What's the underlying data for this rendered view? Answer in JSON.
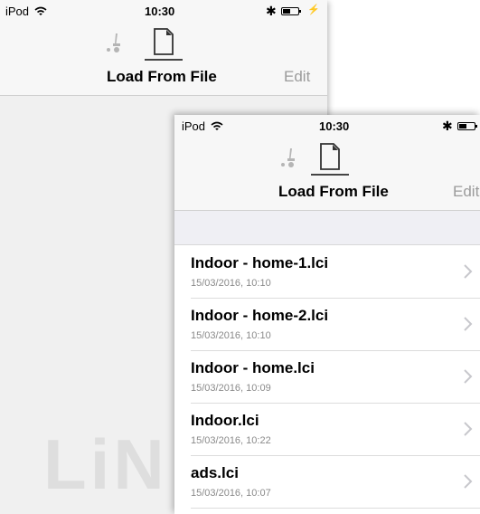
{
  "status_bar": {
    "carrier": "iPod",
    "time": "10:30",
    "bluetooth": "✱",
    "charging": "⚡"
  },
  "navbar": {
    "title": "Load From File",
    "edit_label": "Edit",
    "tabs": [
      {
        "icon": "wheelchair-icon",
        "selected": false
      },
      {
        "icon": "file-icon",
        "selected": true
      }
    ]
  },
  "watermark": {
    "text": "LiN"
  },
  "files": [
    {
      "name": "Indoor - home-1.lci",
      "date": "15/03/2016, 10:10"
    },
    {
      "name": "Indoor - home-2.lci",
      "date": "15/03/2016, 10:10"
    },
    {
      "name": "Indoor - home.lci",
      "date": "15/03/2016, 10:09"
    },
    {
      "name": "Indoor.lci",
      "date": "15/03/2016, 10:22"
    },
    {
      "name": "ads.lci",
      "date": "15/03/2016, 10:07"
    }
  ],
  "colors": {
    "navbar_bg": "#f7f7f7",
    "edit_text": "#9b9b9b",
    "subtitle_text": "#8a8a8a",
    "group_band": "#efeff4"
  }
}
